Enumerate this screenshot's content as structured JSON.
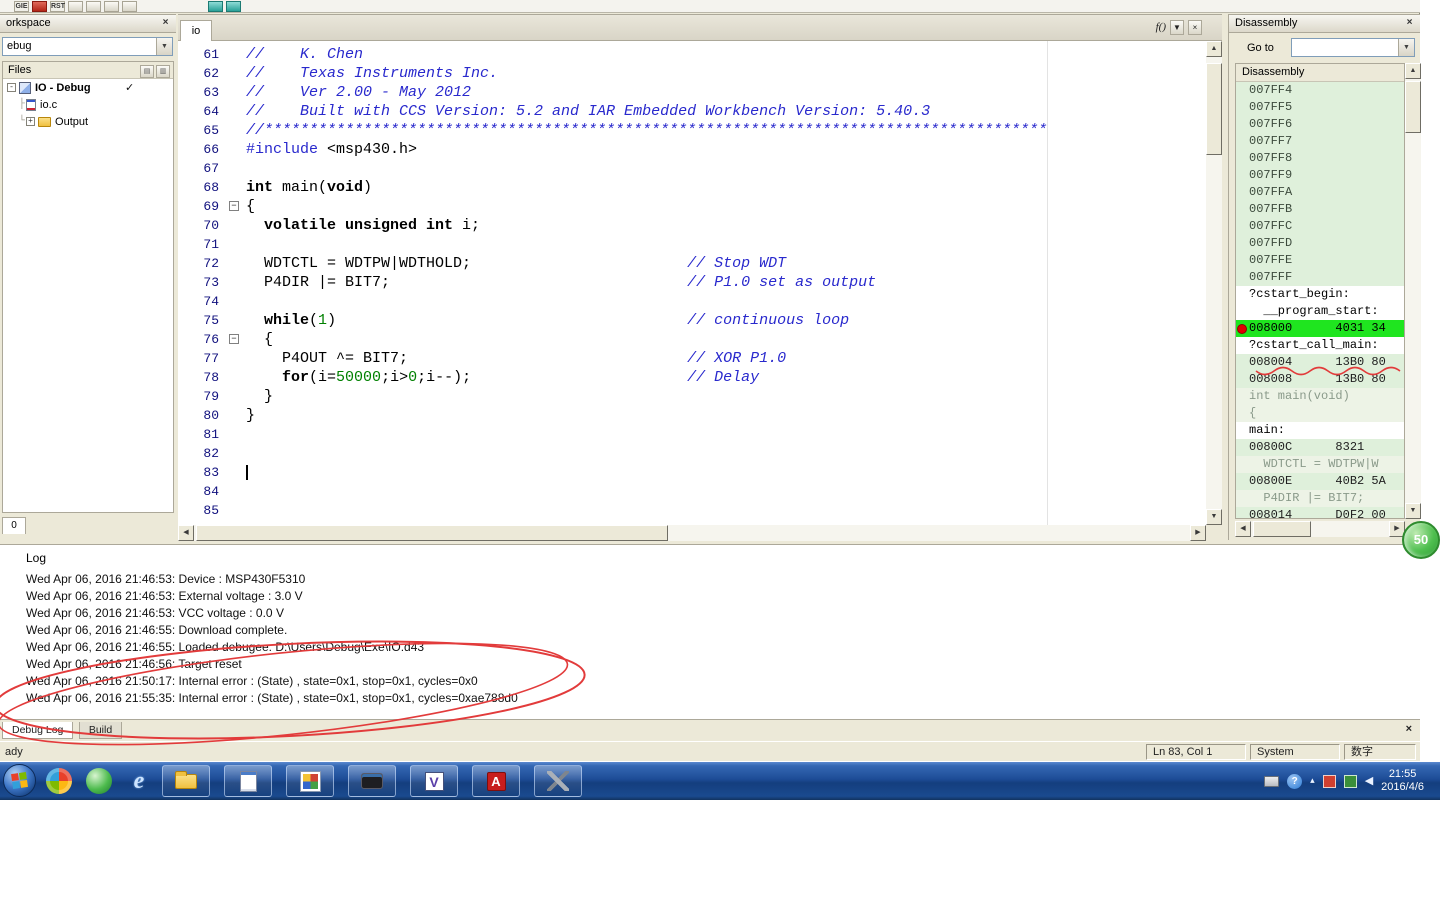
{
  "top_toolbar": {
    "buttons": [
      {
        "name": "gie-toggle-icon",
        "label": "GIE",
        "style": "txt"
      },
      {
        "name": "power-log-icon",
        "label": "",
        "style": "red"
      },
      {
        "name": "rst-toggle-icon",
        "label": "RST",
        "style": "txt"
      },
      {
        "name": "stack-window-icon",
        "label": "",
        "style": "gray"
      },
      {
        "name": "terminal-io-icon",
        "label": "",
        "style": "gray"
      },
      {
        "name": "register-window-icon",
        "label": "",
        "style": "gray"
      },
      {
        "name": "memory-window-icon",
        "label": "",
        "style": "gray"
      },
      {
        "name": "timeline-window-icon",
        "label": "",
        "style": "teal",
        "sep": true
      },
      {
        "name": "symbols-window-icon",
        "label": "",
        "style": "teal"
      }
    ]
  },
  "workspace": {
    "title": "orkspace",
    "config": "ebug",
    "files_header": "Files",
    "tree": [
      {
        "kind": "project",
        "label": "IO - Debug",
        "bold": true,
        "expander": "-",
        "checked": "✓"
      },
      {
        "kind": "file",
        "label": "io.c",
        "indent": 1,
        "conn": "├"
      },
      {
        "kind": "folder",
        "label": "Output",
        "indent": 1,
        "conn": "└",
        "expander": "+"
      }
    ],
    "bottom_tab": "0"
  },
  "editor": {
    "tab": "io",
    "fn_label": "f()",
    "lines": [
      {
        "no": 61,
        "seg": [
          [
            "cm",
            "//    K. Chen"
          ]
        ]
      },
      {
        "no": 62,
        "seg": [
          [
            "cm",
            "//    Texas Instruments Inc."
          ]
        ]
      },
      {
        "no": 63,
        "seg": [
          [
            "cm",
            "//    Ver 2.00 - May 2012"
          ]
        ]
      },
      {
        "no": 64,
        "seg": [
          [
            "cm",
            "//    Built with CCS Version: 5.2 and IAR Embedded Workbench Version: 5.40.3"
          ]
        ]
      },
      {
        "no": 65,
        "seg": [
          [
            "cm",
            "//***************************************************************************************"
          ]
        ]
      },
      {
        "no": 66,
        "seg": [
          [
            "pp",
            "#include"
          ],
          [
            "tx",
            " <msp430.h>"
          ]
        ]
      },
      {
        "no": 67,
        "seg": []
      },
      {
        "no": 68,
        "seg": [
          [
            "kw",
            "int"
          ],
          [
            "tx",
            " main("
          ],
          [
            "kw",
            "void"
          ],
          [
            "tx",
            ")"
          ]
        ]
      },
      {
        "no": 69,
        "fold": true,
        "seg": [
          [
            "tx",
            "{"
          ]
        ]
      },
      {
        "no": 70,
        "seg": [
          [
            "tx",
            "  "
          ],
          [
            "kw",
            "volatile unsigned int"
          ],
          [
            "tx",
            " i;"
          ]
        ]
      },
      {
        "no": 71,
        "seg": []
      },
      {
        "no": 72,
        "seg": [
          [
            "tx",
            "  WDTCTL = WDTPW|WDTHOLD;"
          ],
          [
            "pad",
            24
          ],
          [
            "cm",
            "// Stop WDT"
          ]
        ]
      },
      {
        "no": 73,
        "seg": [
          [
            "tx",
            "  P4DIR |= BIT7;"
          ],
          [
            "pad",
            33
          ],
          [
            "cm",
            "// P1.0 set as output"
          ]
        ]
      },
      {
        "no": 74,
        "seg": []
      },
      {
        "no": 75,
        "seg": [
          [
            "tx",
            "  "
          ],
          [
            "kw",
            "while"
          ],
          [
            "tx",
            "("
          ],
          [
            "num",
            "1"
          ],
          [
            "tx",
            ")"
          ],
          [
            "pad",
            39
          ],
          [
            "cm",
            "// continuous loop"
          ]
        ]
      },
      {
        "no": 76,
        "fold": true,
        "seg": [
          [
            "tx",
            "  {"
          ]
        ]
      },
      {
        "no": 77,
        "seg": [
          [
            "tx",
            "    P4OUT ^= BIT7;"
          ],
          [
            "pad",
            31
          ],
          [
            "cm",
            "// XOR P1.0"
          ]
        ]
      },
      {
        "no": 78,
        "seg": [
          [
            "tx",
            "    "
          ],
          [
            "kw",
            "for"
          ],
          [
            "tx",
            "(i="
          ],
          [
            "num",
            "50000"
          ],
          [
            "tx",
            ";i>"
          ],
          [
            "num",
            "0"
          ],
          [
            "tx",
            ";i--);"
          ],
          [
            "pad",
            24
          ],
          [
            "cm",
            "// Delay"
          ]
        ]
      },
      {
        "no": 79,
        "seg": [
          [
            "tx",
            "  }"
          ]
        ]
      },
      {
        "no": 80,
        "seg": [
          [
            "tx",
            "}"
          ]
        ]
      },
      {
        "no": 81,
        "seg": []
      },
      {
        "no": 82,
        "seg": []
      },
      {
        "no": 83,
        "cursor": true,
        "seg": []
      },
      {
        "no": 84,
        "seg": []
      },
      {
        "no": 85,
        "seg": []
      }
    ]
  },
  "disassembly": {
    "title": "Disassembly",
    "goto_label": "Go to",
    "header": "Disassembly",
    "rows": [
      {
        "t": "addr",
        "x": "007FF4"
      },
      {
        "t": "addr",
        "x": "007FF5"
      },
      {
        "t": "addr",
        "x": "007FF6"
      },
      {
        "t": "addr",
        "x": "007FF7"
      },
      {
        "t": "addr",
        "x": "007FF8"
      },
      {
        "t": "addr",
        "x": "007FF9"
      },
      {
        "t": "addr",
        "x": "007FFA"
      },
      {
        "t": "addr",
        "x": "007FFB"
      },
      {
        "t": "addr",
        "x": "007FFC"
      },
      {
        "t": "addr",
        "x": "007FFD"
      },
      {
        "t": "addr",
        "x": "007FFE"
      },
      {
        "t": "addr",
        "x": "007FFF"
      },
      {
        "t": "label",
        "x": "?cstart_begin:"
      },
      {
        "t": "label",
        "x": "  __program_start:"
      },
      {
        "t": "current",
        "x": "008000      4031 34",
        "bp": true
      },
      {
        "t": "label",
        "x": "?cstart_call_main:"
      },
      {
        "t": "code",
        "x": "008004      13B0 80"
      },
      {
        "t": "code",
        "x": "008008      13B0 80"
      },
      {
        "t": "src",
        "x": "int main(void)"
      },
      {
        "t": "src",
        "x": "{"
      },
      {
        "t": "label",
        "x": "main:"
      },
      {
        "t": "code",
        "x": "00800C      8321"
      },
      {
        "t": "src",
        "x": "  WDTCTL = WDTPW|W"
      },
      {
        "t": "code",
        "x": "00800E      40B2 5A"
      },
      {
        "t": "src",
        "x": "  P4DIR |= BIT7;"
      },
      {
        "t": "code",
        "x": "008014      D0F2 00"
      }
    ]
  },
  "log": {
    "title": "Log",
    "lines": [
      "Wed Apr 06, 2016 21:46:53: Device : MSP430F5310",
      "Wed Apr 06, 2016 21:46:53: External voltage : 3.0 V",
      "Wed Apr 06, 2016 21:46:53: VCC voltage : 0.0 V",
      "Wed Apr 06, 2016 21:46:55: Download complete.",
      "Wed Apr 06, 2016 21:46:55: Loaded debugee: D:\\Users\\Debug\\Exe\\IO.d43",
      "Wed Apr 06, 2016 21:46:56: Target reset",
      "Wed Apr 06, 2016 21:50:17: Internal error : (State) , state=0x1, stop=0x1, cycles=0x0",
      "Wed Apr 06, 2016 21:55:35: Internal error : (State) , state=0x1, stop=0x1, cycles=0xae788d0"
    ],
    "tabs": [
      "Debug Log",
      "Build"
    ]
  },
  "status_bar": {
    "ready": "ady",
    "position": "Ln 83, Col 1",
    "system": "System",
    "ime": "数字"
  },
  "taskbar": {
    "quick": [
      {
        "name": "pinwheel-browser-icon",
        "icon": "pinwheel"
      },
      {
        "name": "green-orb-app-icon",
        "icon": "green-orb"
      },
      {
        "name": "internet-explorer-icon",
        "icon": "ie",
        "glyph": "e"
      }
    ],
    "buttons": [
      {
        "name": "folder-window-button",
        "icon": "folder"
      },
      {
        "name": "journal-window-button",
        "icon": "journal"
      },
      {
        "name": "setup-window-button",
        "icon": "setup"
      },
      {
        "name": "device-app-window-button",
        "icon": "device"
      },
      {
        "name": "iar-workbench-window-button",
        "icon": "iar",
        "glyph": "V"
      },
      {
        "name": "adobe-reader-window-button",
        "icon": "pdf",
        "glyph": "A"
      },
      {
        "name": "tools-app-window-button",
        "icon": "tools"
      }
    ],
    "tray": [
      {
        "name": "printer-tray-icon",
        "icon": "printer"
      },
      {
        "name": "help-tray-icon",
        "icon": "help",
        "glyph": "?"
      },
      {
        "name": "show-hidden-icons-chevron",
        "icon": "chevron",
        "glyph": "▴"
      },
      {
        "name": "language-red-tray-icon",
        "icon": "lang-red"
      },
      {
        "name": "language-green-tray-icon",
        "icon": "lang-green"
      },
      {
        "name": "speaker-tray-icon",
        "icon": "speaker",
        "glyph": "◀"
      }
    ],
    "clock_time": "21:55",
    "clock_date": "2016/4/6"
  },
  "overlay": {
    "badge": "50"
  }
}
